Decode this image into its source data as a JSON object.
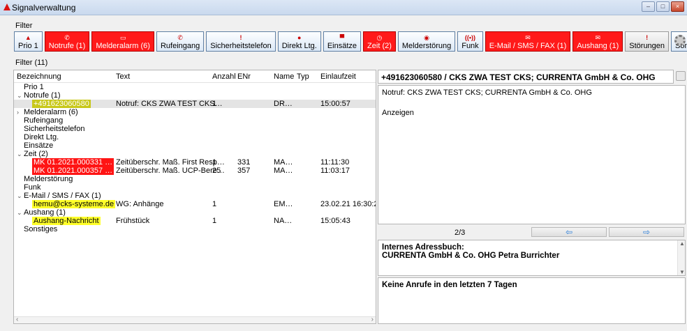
{
  "window": {
    "title": "Signalverwaltung"
  },
  "menu": {
    "filter_label": "Filter"
  },
  "colors": {
    "alarm_red": "#ff1414",
    "highlight_yellow": "#ffff29",
    "selected_olive": "#c8c81a",
    "button_blue": "#dbe8f6"
  },
  "toolbar": {
    "buttons": [
      {
        "label": "Prio 1",
        "icon": "triangle-icon",
        "glyph": "▲",
        "style": "normal"
      },
      {
        "label": "Notrufe (1)",
        "icon": "phone-icon",
        "glyph": "✆",
        "style": "red"
      },
      {
        "label": "Melderalarm (6)",
        "icon": "alarm-box-icon",
        "glyph": "▭",
        "style": "red"
      },
      {
        "label": "Rufeingang",
        "icon": "handset-icon",
        "glyph": "✆",
        "style": "normal"
      },
      {
        "label": "Sicherheitstelefon",
        "icon": "exclamation-icon",
        "glyph": "!",
        "style": "normal"
      },
      {
        "label": "Direkt Ltg.",
        "icon": "direct-line-icon",
        "glyph": "●",
        "style": "normal"
      },
      {
        "label": "Einsätze",
        "icon": "siren-icon",
        "glyph": "▀",
        "style": "normal"
      },
      {
        "label": "Zeit (2)",
        "icon": "clock-icon",
        "glyph": "◷",
        "style": "red"
      },
      {
        "label": "Melderstörung",
        "icon": "fault-icon",
        "glyph": "◉",
        "style": "normal"
      },
      {
        "label": "Funk",
        "icon": "radio-icon",
        "glyph": "((•))",
        "style": "normal"
      },
      {
        "label": "E-Mail / SMS / FAX (1)",
        "icon": "email-globe-icon",
        "glyph": "✉",
        "style": "red"
      },
      {
        "label": "Aushang (1)",
        "icon": "envelope-icon",
        "glyph": "✉",
        "style": "red"
      },
      {
        "label": "Störungen",
        "icon": "exclamation-icon",
        "glyph": "!",
        "style": "gray"
      },
      {
        "label": "Sonstiges",
        "icon": "folder-icon",
        "glyph": "▬",
        "style": "normal"
      }
    ]
  },
  "filter": {
    "count_label": "Filter (11)"
  },
  "table": {
    "columns": [
      "Bezeichnung",
      "Text",
      "Anzahl",
      "ENr",
      "Name",
      "Typ",
      "Einlaufzeit"
    ],
    "rows": [
      {
        "kind": "group",
        "label": "Prio 1",
        "expand": ""
      },
      {
        "kind": "group",
        "label": "Notrufe (1)",
        "expand": "⌄"
      },
      {
        "kind": "item",
        "bez": "+491623060580",
        "hl": "olive",
        "text": "Notruf: CKS ZWA TEST CKS…",
        "anzahl": "1",
        "enr": "",
        "name": "DR…",
        "typ": "",
        "zeit": "15:00:57",
        "selected": true
      },
      {
        "kind": "group",
        "label": "Melderalarm (6)",
        "expand": "›"
      },
      {
        "kind": "group",
        "label": "Rufeingang",
        "expand": ""
      },
      {
        "kind": "group",
        "label": "Sicherheitstelefon",
        "expand": ""
      },
      {
        "kind": "group",
        "label": "Direkt Ltg.",
        "expand": ""
      },
      {
        "kind": "group",
        "label": "Einsätze",
        "expand": ""
      },
      {
        "kind": "group",
        "label": "Zeit (2)",
        "expand": "⌄"
      },
      {
        "kind": "item",
        "bez": "MK 01.2021.000331 …",
        "hl": "red",
        "text": "Zeitüberschr. Maß. First Resp…",
        "anzahl": "1",
        "enr": "331",
        "name": "MA…",
        "typ": "",
        "zeit": "11:11:30"
      },
      {
        "kind": "item",
        "bez": "MK 01.2021.000357 …",
        "hl": "red",
        "text": "Zeitüberschr. Maß. UCP-Bere…",
        "anzahl": "25",
        "enr": "357",
        "name": "MA…",
        "typ": "",
        "zeit": "11:03:17"
      },
      {
        "kind": "group",
        "label": "Melderstörung",
        "expand": ""
      },
      {
        "kind": "group",
        "label": "Funk",
        "expand": ""
      },
      {
        "kind": "group",
        "label": "E-Mail / SMS / FAX (1)",
        "expand": "⌄"
      },
      {
        "kind": "item",
        "bez": "hemu@cks-systeme.de",
        "hl": "yellow",
        "text": "WG: Anhänge",
        "anzahl": "1",
        "enr": "",
        "name": "EM…",
        "typ": "",
        "zeit": "23.02.21 16:30:2"
      },
      {
        "kind": "group",
        "label": "Aushang (1)",
        "expand": "⌄"
      },
      {
        "kind": "item",
        "bez": "Aushang-Nachricht",
        "hl": "yellow",
        "text": "Frühstück",
        "anzahl": "1",
        "enr": "",
        "name": "NA…",
        "typ": "",
        "zeit": "15:05:43"
      },
      {
        "kind": "group",
        "label": "Sonstiges",
        "expand": ""
      }
    ]
  },
  "detail": {
    "header": "+491623060580 / CKS ZWA TEST CKS; CURRENTA GmbH & Co. OHG",
    "body_line1": "Notruf: CKS ZWA TEST CKS; CURRENTA GmbH & Co. OHG",
    "body_line2": "Anzeigen"
  },
  "pager": {
    "count": "2/3",
    "prev": "⇦",
    "next": "⇨"
  },
  "address": {
    "title": "Internes Adressbuch:",
    "entry": "CURRENTA GmbH & Co. OHG Petra Burrichter"
  },
  "calls": {
    "text": "Keine Anrufe in den letzten 7 Tagen"
  }
}
